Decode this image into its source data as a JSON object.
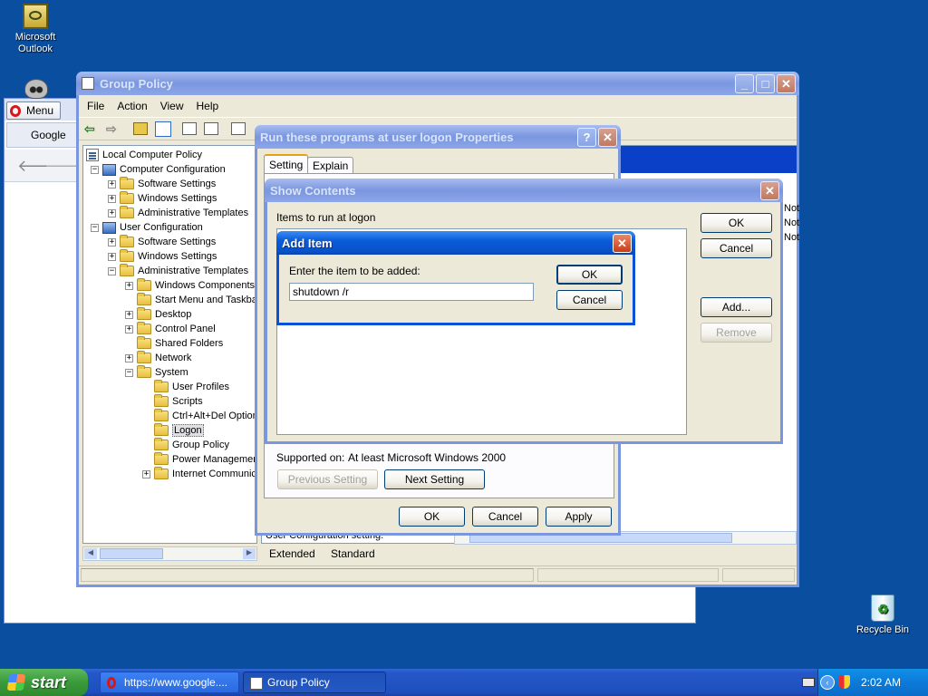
{
  "desktop": {
    "icons": [
      {
        "label_line1": "Microsoft",
        "label_line2": "Outlook"
      },
      {
        "label": "Recycle Bin"
      }
    ]
  },
  "browser": {
    "menu_label": "Menu",
    "tab_label": "Google"
  },
  "gp_window": {
    "title": "Group Policy",
    "menu": [
      "File",
      "Action",
      "View",
      "Help"
    ],
    "tree": [
      {
        "label": "Local Computer Policy",
        "depth": 0,
        "icon": "policy"
      },
      {
        "label": "Computer Configuration",
        "depth": 1,
        "icon": "computer",
        "toggle": "-"
      },
      {
        "label": "Software Settings",
        "depth": 2,
        "icon": "folder",
        "toggle": "+"
      },
      {
        "label": "Windows Settings",
        "depth": 2,
        "icon": "folder",
        "toggle": "+"
      },
      {
        "label": "Administrative Templates",
        "depth": 2,
        "icon": "folder",
        "toggle": "+"
      },
      {
        "label": "User Configuration",
        "depth": 1,
        "icon": "user",
        "toggle": "-"
      },
      {
        "label": "Software Settings",
        "depth": 2,
        "icon": "folder",
        "toggle": "+"
      },
      {
        "label": "Windows Settings",
        "depth": 2,
        "icon": "folder",
        "toggle": "+"
      },
      {
        "label": "Administrative Templates",
        "depth": 2,
        "icon": "folder",
        "toggle": "-"
      },
      {
        "label": "Windows Components",
        "depth": 3,
        "icon": "folder",
        "toggle": "+"
      },
      {
        "label": "Start Menu and Taskbar",
        "depth": 3,
        "icon": "folder",
        "toggle": ""
      },
      {
        "label": "Desktop",
        "depth": 3,
        "icon": "folder",
        "toggle": "+"
      },
      {
        "label": "Control Panel",
        "depth": 3,
        "icon": "folder",
        "toggle": "+"
      },
      {
        "label": "Shared Folders",
        "depth": 3,
        "icon": "folder",
        "toggle": ""
      },
      {
        "label": "Network",
        "depth": 3,
        "icon": "folder",
        "toggle": "+"
      },
      {
        "label": "System",
        "depth": 3,
        "icon": "folder",
        "toggle": "-"
      },
      {
        "label": "User Profiles",
        "depth": 4,
        "icon": "folder",
        "toggle": ""
      },
      {
        "label": "Scripts",
        "depth": 4,
        "icon": "folder",
        "toggle": ""
      },
      {
        "label": "Ctrl+Alt+Del Options",
        "depth": 4,
        "icon": "folder",
        "toggle": ""
      },
      {
        "label": "Logon",
        "depth": 4,
        "icon": "folder",
        "toggle": "",
        "selected": true
      },
      {
        "label": "Group Policy",
        "depth": 4,
        "icon": "folder",
        "toggle": ""
      },
      {
        "label": "Power Management",
        "depth": 4,
        "icon": "folder",
        "toggle": ""
      },
      {
        "label": "Internet Communication",
        "depth": 4,
        "icon": "folder",
        "toggle": "+"
      }
    ],
    "right_col_text": [
      "Not",
      "Not",
      "Not"
    ],
    "status_row_text": "User Configuration setting.",
    "view_tabs": [
      "Extended",
      "Standard"
    ]
  },
  "props_dialog": {
    "title": "Run these programs at user logon Properties",
    "tabs": [
      "Setting",
      "Explain"
    ],
    "supported_label": "Supported on:",
    "supported_value": "At least Microsoft Windows 2000",
    "prev_label": "Previous Setting",
    "next_label": "Next Setting",
    "ok_label": "OK",
    "cancel_label": "Cancel",
    "apply_label": "Apply"
  },
  "show_contents": {
    "title": "Show Contents",
    "list_label": "Items to run at logon",
    "ok_label": "OK",
    "cancel_label": "Cancel",
    "add_label": "Add...",
    "remove_label": "Remove"
  },
  "add_item": {
    "title": "Add Item",
    "prompt": "Enter the item to be added:",
    "value": "shutdown /r",
    "ok_label": "OK",
    "cancel_label": "Cancel"
  },
  "taskbar": {
    "start_label": "start",
    "tasks": [
      "https://www.google....",
      "Group Policy"
    ],
    "clock": "2:02 AM"
  },
  "colors": {
    "desktop": "#0a4ea0",
    "titlebar": "#0a5cd8",
    "window": "#ece9d8"
  }
}
